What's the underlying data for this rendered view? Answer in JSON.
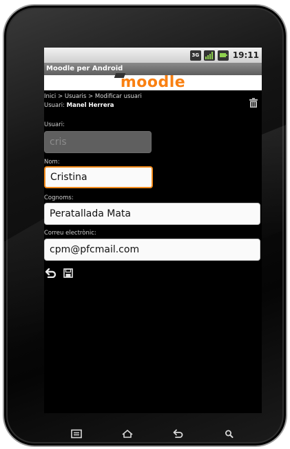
{
  "status_bar": {
    "network_type": "3G",
    "time": "19:11",
    "icons": [
      "3g-icon",
      "signal-icon",
      "battery-icon"
    ]
  },
  "app": {
    "title": "Moodle per Android",
    "logo_text": "moodle"
  },
  "breadcrumb": "Inici > Usuaris > Modificar usuari",
  "user_line": {
    "prefix": "Usuari: ",
    "name": "Manel Herrera"
  },
  "form": {
    "username": {
      "label": "Usuari:",
      "value": "cris",
      "state": "disabled"
    },
    "first_name": {
      "label": "Nom:",
      "value": "Cristina",
      "state": "focused"
    },
    "last_name": {
      "label": "Cognoms:",
      "value": "Peratallada Mata",
      "state": "normal"
    },
    "email": {
      "label": "Correu electrònic:",
      "value": "cpm@pfcmail.com",
      "state": "normal"
    }
  },
  "actions": {
    "icons": [
      "back-icon",
      "save-icon"
    ]
  },
  "header_actions": {
    "icons": [
      "trash-icon"
    ]
  },
  "system_nav": {
    "icons": [
      "menu-icon",
      "home-icon",
      "back-icon",
      "search-icon"
    ]
  },
  "colors": {
    "accent": "#f98012",
    "focus_border": "#f28a1a",
    "title_bar": "#6e6e6e",
    "screen_bg": "#000000"
  }
}
